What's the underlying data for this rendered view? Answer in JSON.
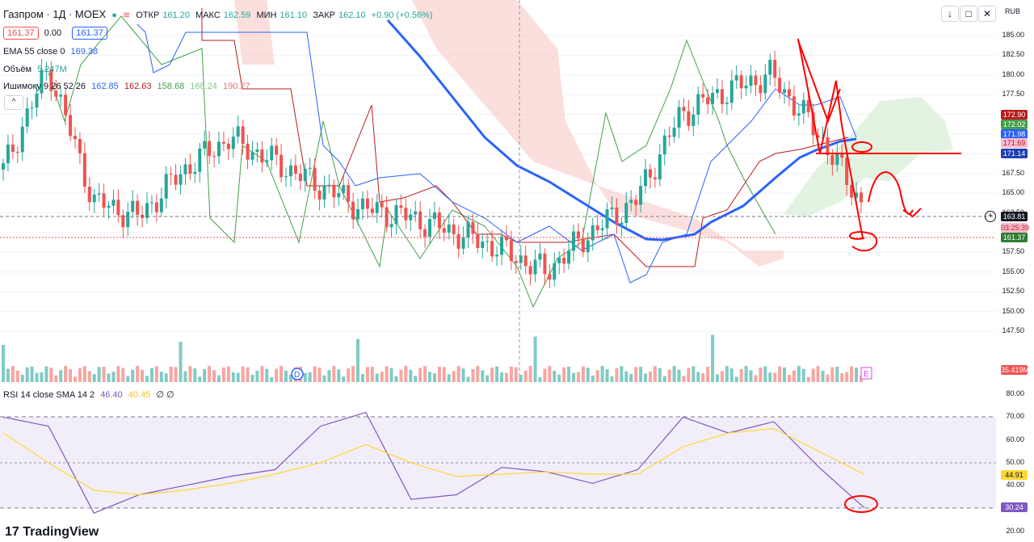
{
  "header": {
    "symbol": "Газпром · 1Д · MOEX",
    "open_label": "ОТКР",
    "open": "161.20",
    "high_label": "МАКС",
    "high": "162.59",
    "low_label": "МИН",
    "low": "161.10",
    "close_label": "ЗАКР",
    "close": "162.10",
    "change": "+0.90 (+0.56%)",
    "currency": "RUB",
    "bid": "161.37",
    "spread": "0.00",
    "ask": "161.37"
  },
  "indicators": {
    "ema_label": "EMA 55 close 0",
    "ema_value": "169.38",
    "volume_label": "Объём",
    "volume_value": "5.247M",
    "ichimoku_label": "Ишимоку 9 26 52 26",
    "ichimoku_values": [
      "162.85",
      "162.63",
      "158.68",
      "168.24",
      "190.27"
    ],
    "rsi_label": "RSI 14 close SMA 14 2",
    "rsi_value": "46.40",
    "rsi_sma_value": "40.45",
    "rsi_extra": "∅ ∅"
  },
  "price_axis": [
    "185.00",
    "182.50",
    "180.00",
    "177.50",
    "175.00",
    "172.50",
    "170.00",
    "167.50",
    "165.00",
    "162.50",
    "160.00",
    "157.50",
    "155.00",
    "152.50",
    "150.00",
    "147.50"
  ],
  "rsi_axis": [
    "80.00",
    "70.00",
    "60.00",
    "50.00",
    "40.00",
    "30.00",
    "20.00"
  ],
  "price_tags": [
    {
      "text": "172.90",
      "color": "#b71c1c"
    },
    {
      "text": "172.02",
      "color": "#43a047"
    },
    {
      "text": "171.98",
      "color": "#2962ff"
    },
    {
      "text": "171.69",
      "color": "#f8bbd0"
    },
    {
      "text": "171.14",
      "color": "#1e40af"
    },
    {
      "text": "163.81",
      "color": "#131722"
    },
    {
      "text": "03:25:39",
      "color": "#f8bbd0"
    },
    {
      "text": "161.37",
      "color": "#2e7d32"
    },
    {
      "text": "35.419M",
      "color": "#ef5350"
    }
  ],
  "rsi_tags": [
    {
      "text": "44.91",
      "color": "#fdd835"
    },
    {
      "text": "30.24",
      "color": "#7e57c2"
    }
  ],
  "markers": {
    "dividend": "D",
    "earnings": "E"
  },
  "brand": "TradingView",
  "chart_data": {
    "type": "line",
    "title": "Газпром · 1Д · MOEX",
    "ylim": [
      146,
      186.5
    ],
    "series": [
      {
        "name": "EMA 55 close 0",
        "values": [
          187,
          184,
          180,
          176,
          172,
          168,
          165,
          163,
          162,
          161,
          160.5,
          160.6,
          161,
          162,
          164,
          167,
          169,
          170.5,
          171.5,
          171.14
        ]
      },
      {
        "name": "Close",
        "values": [
          168,
          181,
          164,
          162,
          168,
          172,
          169,
          166,
          163,
          162,
          160,
          158,
          155,
          160,
          164,
          175,
          178,
          180,
          173,
          163.81
        ]
      }
    ],
    "rsi": {
      "ylim": [
        20,
        80
      ],
      "overbought": 70,
      "oversold": 30,
      "values": [
        70,
        66,
        28,
        36,
        40,
        44,
        47,
        66,
        72,
        34,
        36,
        48,
        46,
        41,
        47,
        70,
        63,
        68,
        48,
        30.24
      ],
      "sma": [
        63,
        50,
        38,
        36,
        38,
        41,
        45,
        50,
        58,
        50,
        44,
        45,
        46,
        45,
        45,
        57,
        63,
        65,
        55,
        44.91
      ]
    }
  }
}
